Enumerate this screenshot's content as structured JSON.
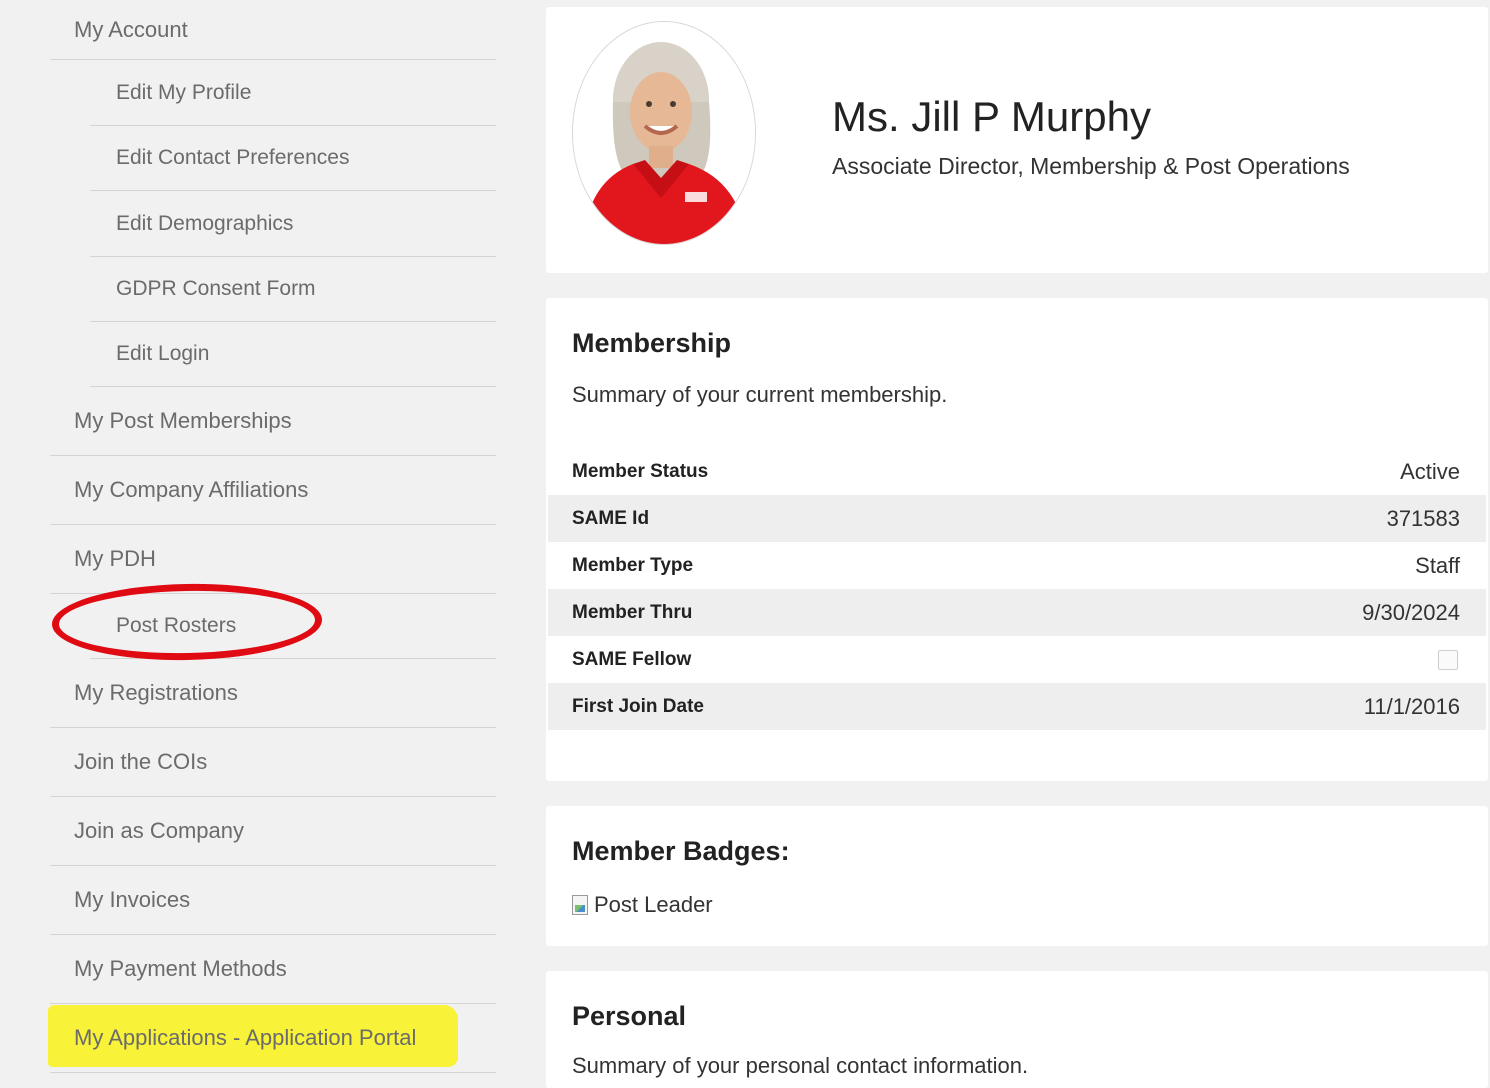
{
  "sidebar": {
    "items": [
      {
        "label": "My Account"
      },
      {
        "label": "Edit My Profile"
      },
      {
        "label": "Edit Contact Preferences"
      },
      {
        "label": "Edit Demographics"
      },
      {
        "label": "GDPR Consent Form"
      },
      {
        "label": "Edit Login"
      },
      {
        "label": "My Post Memberships"
      },
      {
        "label": "My Company Affiliations"
      },
      {
        "label": "My PDH"
      },
      {
        "label": "Post Rosters"
      },
      {
        "label": "My Registrations"
      },
      {
        "label": "Join the COIs"
      },
      {
        "label": "Join as Company"
      },
      {
        "label": "My Invoices"
      },
      {
        "label": "My Payment Methods"
      },
      {
        "label": "My Applications - Application Portal"
      }
    ]
  },
  "profile": {
    "name": "Ms. Jill P Murphy",
    "role": "Associate Director, Membership & Post Operations"
  },
  "membership": {
    "title": "Membership",
    "description": "Summary of your current membership.",
    "rows": [
      {
        "label": "Member Status",
        "value": "Active"
      },
      {
        "label": "SAME Id",
        "value": "371583"
      },
      {
        "label": "Member Type",
        "value": "Staff"
      },
      {
        "label": "Member Thru",
        "value": "9/30/2024"
      },
      {
        "label": "SAME Fellow",
        "value": ""
      },
      {
        "label": "First Join Date",
        "value": "11/1/2016"
      }
    ]
  },
  "badges": {
    "title": "Member Badges:",
    "items": [
      "Post Leader"
    ]
  },
  "personal": {
    "title": "Personal",
    "description": "Summary of your personal contact information."
  },
  "annotations": {
    "highlight_color": "#f8f238",
    "circle_color": "#e00a12"
  }
}
